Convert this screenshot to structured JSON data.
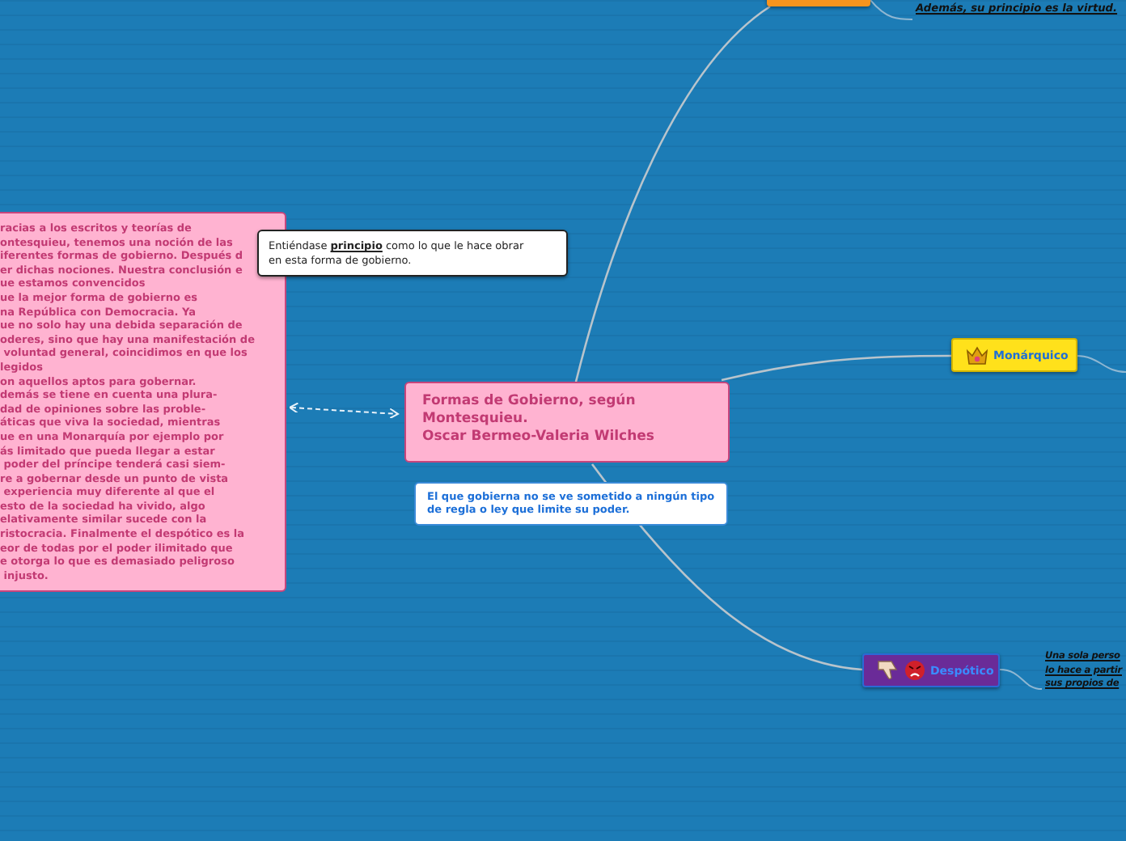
{
  "central_topic": {
    "text": "Formas de Gobierno, según\nMontesquieu.\nOscar Bermeo-Valeria Wilches"
  },
  "central_note": {
    "text": "El que gobierna no se ve sometido a ningún tipo\nde regla o ley que limite su poder."
  },
  "tip": {
    "text": "Entiéndase **principio** como lo que le hace obrar\nen esta forma de gobierno."
  },
  "conclusion_note": {
    "text": "racias a los escritos y teorías de\nontesquieu, tenemos una noción de las\niferentes formas de gobierno. Después d\ner dichas nociones. Nuestra conclusión e\nue estamos convencidos\nue la mejor forma de gobierno es\nna República con Democracia. Ya\nue no solo hay una debida separación de\noderes, sino que hay una manifestación de\n voluntad general, coincidimos en que los\nlegidos\non aquellos aptos para gobernar.\ndemás se tiene en cuenta una plura-\ndad de opiniones sobre las proble-\náticas que viva la sociedad, mientras\nue en una Monarquía por ejemplo por\nás limitado que pueda llegar a estar\n poder del príncipe tenderá casi siem-\nre a gobernar desde un punto de vista\n experiencia muy diferente al que el\nesto de la sociedad ha vivido, algo\nelativamente similar sucede con la\nristocracia. Finalmente el despótico es la\neor de todas por el poder ilimitado que\ne otorga lo que es demasiado peligroso\n injusto."
  },
  "top_topic": {
    "note": "Además, su principio es la virtud."
  },
  "branches": [
    {
      "kind": "monarchy",
      "label": "Monárquico"
    },
    {
      "kind": "despotism",
      "label": "Despótico",
      "note": "Una sola perso\nlo hace a partir\nsus propios de"
    }
  ]
}
